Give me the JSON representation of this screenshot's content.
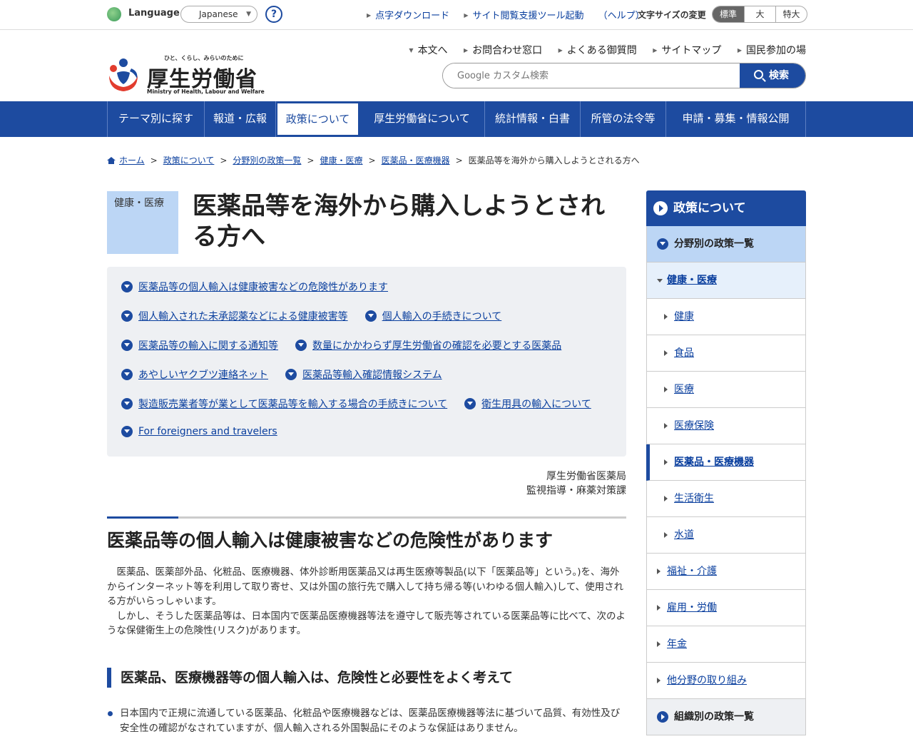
{
  "util": {
    "language_label": "Language",
    "language_value": "Japanese",
    "help": "?",
    "links": [
      "点字ダウンロード",
      "サイト閲覧支援ツール起動",
      "（ヘルプ）"
    ],
    "font_size_label": "文字サイズの変更",
    "font_sizes": [
      "標準",
      "大",
      "特大"
    ]
  },
  "header": {
    "logo_tagline": "ひと、くらし、みらいのために",
    "logo_name": "厚生労働省",
    "logo_en": "Ministry of Health, Labour and Welfare",
    "links": [
      "本文へ",
      "お問合わせ窓口",
      "よくある御質問",
      "サイトマップ",
      "国民参加の場"
    ],
    "search_placeholder": "Google カスタム検索",
    "search_button": "検索"
  },
  "gnav": [
    "テーマ別に探す",
    "報道・広報",
    "政策について",
    "厚生労働省について",
    "統計情報・白書",
    "所管の法令等",
    "申請・募集・情報公開"
  ],
  "breadcrumb": [
    "ホーム",
    "政策について",
    "分野別の政策一覧",
    "健康・医療",
    "医薬品・医療機器",
    "医薬品等を海外から購入しようとされる方へ"
  ],
  "main": {
    "category": "健康・医療",
    "title": "医薬品等を海外から購入しようとされる方へ",
    "links": [
      [
        "医薬品等の個人輸入は健康被害などの危険性があります"
      ],
      [
        "個人輸入された未承認薬などによる健康被害等",
        "個人輸入の手続きについて"
      ],
      [
        "医薬品等の輸入に関する通知等",
        "数量にかかわらず厚生労働省の確認を必要とする医薬品"
      ],
      [
        "あやしいヤクブツ連絡ネット",
        "医薬品等輸入確認情報システム"
      ],
      [
        "製造販売業者等が業として医薬品等を輸入する場合の手続きについて",
        "衛生用具の輸入について"
      ],
      [
        "For foreigners and travelers"
      ]
    ],
    "author_1": "厚生労働省医薬局",
    "author_2": "監視指導・麻薬対策課",
    "h2": "医薬品等の個人輸入は健康被害などの危険性があります",
    "para_1": "　医薬品、医薬部外品、化粧品、医療機器、体外診断用医薬品又は再生医療等製品(以下「医薬品等」という。)を、海外からインターネット等を利用して取り寄せ、又は外国の旅行先で購入して持ち帰る等(いわゆる個人輸入)して、使用される方がいらっしゃいます。",
    "para_2": "　しかし、そうした医薬品等は、日本国内で医薬品医療機器等法を遵守して販売等されている医薬品等に比べて、次のような保健衛生上の危険性(リスク)があります。",
    "h3": "医薬品、医療機器等の個人輸入は、危険性と必要性をよく考えて",
    "bullet_1": "日本国内で正規に流通している医薬品、化粧品や医療機器などは、医薬品医療機器等法に基づいて品質、有効性及び安全性の確認がなされていますが、個人輸入される外国製品にそのような保証はありません。"
  },
  "side": {
    "title": "政策について",
    "l1": "分野別の政策一覧",
    "l2_open": "健康・医療",
    "l3": [
      "健康",
      "食品",
      "医療",
      "医療保険",
      "医薬品・医療機器",
      "生活衛生",
      "水道"
    ],
    "l2": [
      "福祉・介護",
      "雇用・労働",
      "年金",
      "他分野の取り組み"
    ],
    "org": "組織別の政策一覧"
  }
}
